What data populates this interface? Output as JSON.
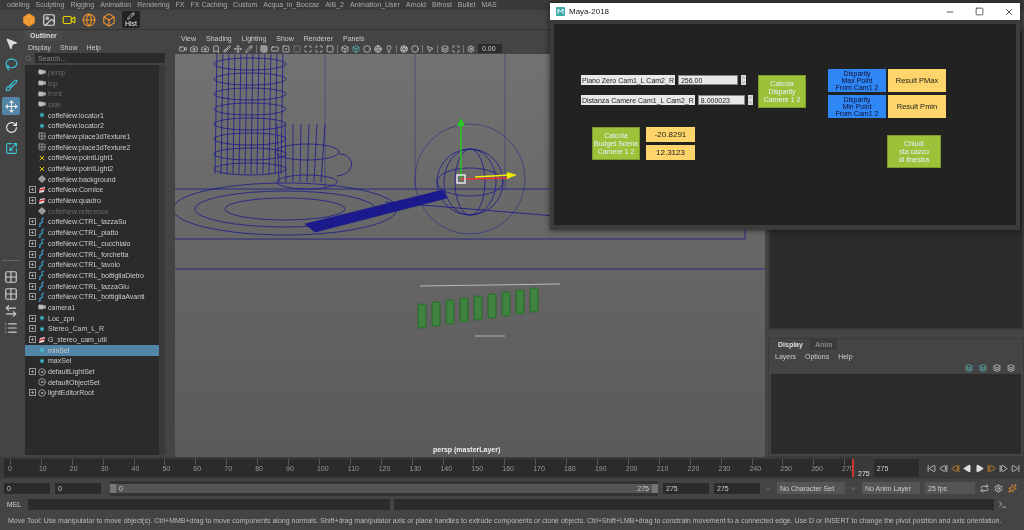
{
  "shelf_tabs": [
    "odeling",
    "Sculpting",
    "Rigging",
    "Animation",
    "Rendering",
    "FX",
    "FX Caching",
    "Custom",
    "Acqua_in_Boccaz",
    "AiB_2",
    "Animation_User",
    "Arnold",
    "Bifrost",
    "Bullet",
    "MAS"
  ],
  "shelf": {
    "hist_label": "Hist"
  },
  "tools": [
    {
      "kind": "select",
      "selected": false
    },
    {
      "kind": "lasso",
      "selected": false
    },
    {
      "kind": "paint",
      "selected": false
    },
    {
      "kind": "move",
      "selected": true
    },
    {
      "kind": "rotate",
      "selected": false
    },
    {
      "kind": "scale",
      "selected": false
    }
  ],
  "outliner": {
    "title": "Outliner",
    "menu": [
      "Display",
      "Show",
      "Help"
    ],
    "search": {
      "placeholder": "Search..."
    },
    "items": [
      {
        "label": "persp",
        "kind": "camera",
        "dimmed": true,
        "expandable": false,
        "selected": false
      },
      {
        "label": "top",
        "kind": "camera",
        "dimmed": true,
        "expandable": false,
        "selected": false
      },
      {
        "label": "front",
        "kind": "camera",
        "dimmed": true,
        "expandable": false,
        "selected": false
      },
      {
        "label": "side",
        "kind": "camera",
        "dimmed": true,
        "expandable": false,
        "selected": false
      },
      {
        "label": "coffeNew:locator1",
        "kind": "locator",
        "dimmed": false,
        "expandable": false,
        "selected": false
      },
      {
        "label": "coffeNew:locator2",
        "kind": "locator",
        "dimmed": false,
        "expandable": false,
        "selected": false
      },
      {
        "label": "coffeNew:place3dTexture1",
        "kind": "texture",
        "dimmed": false,
        "expandable": false,
        "selected": false
      },
      {
        "label": "coffeNew:place3dTexture2",
        "kind": "texture",
        "dimmed": false,
        "expandable": false,
        "selected": false
      },
      {
        "label": "coffeNew:pointLight1",
        "kind": "light",
        "dimmed": false,
        "expandable": false,
        "selected": false
      },
      {
        "label": "coffeNew:pointLight2",
        "kind": "light",
        "dimmed": false,
        "expandable": false,
        "selected": false
      },
      {
        "label": "coffeNew:background",
        "kind": "transform",
        "dimmed": false,
        "expandable": false,
        "selected": false
      },
      {
        "label": "coffeNew:Cornice",
        "kind": "mesh",
        "dimmed": false,
        "expandable": true,
        "selected": false
      },
      {
        "label": "coffeNew:quadro",
        "kind": "mesh",
        "dimmed": false,
        "expandable": true,
        "selected": false
      },
      {
        "label": "coffeNew:reference",
        "kind": "transform",
        "dimmed": true,
        "expandable": false,
        "selected": false
      },
      {
        "label": "coffeNew:CTRL_tazzaSu",
        "kind": "curve",
        "dimmed": false,
        "expandable": true,
        "selected": false
      },
      {
        "label": "coffeNew:CTRL_piatto",
        "kind": "curve",
        "dimmed": false,
        "expandable": true,
        "selected": false
      },
      {
        "label": "coffeNew:CTRL_cucchiaio",
        "kind": "curve",
        "dimmed": false,
        "expandable": true,
        "selected": false
      },
      {
        "label": "coffeNew:CTRL_forchetta",
        "kind": "curve",
        "dimmed": false,
        "expandable": true,
        "selected": false
      },
      {
        "label": "coffeNew:CTRL_tavolo",
        "kind": "curve",
        "dimmed": false,
        "expandable": true,
        "selected": false
      },
      {
        "label": "coffeNew:CTRL_bottigliaDietro",
        "kind": "curve",
        "dimmed": false,
        "expandable": true,
        "selected": false
      },
      {
        "label": "coffeNew:CTRL_tazzaGiu",
        "kind": "curve",
        "dimmed": false,
        "expandable": true,
        "selected": false
      },
      {
        "label": "coffeNew:CTRL_bottigliaAvanti",
        "kind": "curve",
        "dimmed": false,
        "expandable": true,
        "selected": false
      },
      {
        "label": "camera1",
        "kind": "camera",
        "dimmed": false,
        "expandable": false,
        "selected": false
      },
      {
        "label": "Loc_zpn",
        "kind": "locator",
        "dimmed": false,
        "expandable": true,
        "selected": false
      },
      {
        "label": "Stereo_Cam_L_R",
        "kind": "locator",
        "dimmed": false,
        "expandable": true,
        "selected": false
      },
      {
        "label": "G_stereo_cam_util",
        "kind": "mesh",
        "dimmed": false,
        "expandable": true,
        "selected": false
      },
      {
        "label": "minSel",
        "kind": "locator",
        "dimmed": false,
        "expandable": false,
        "selected": true
      },
      {
        "label": "maxSel",
        "kind": "locator",
        "dimmed": false,
        "expandable": false,
        "selected": false
      },
      {
        "label": "defaultLightSet",
        "kind": "set",
        "dimmed": false,
        "expandable": true,
        "selected": false
      },
      {
        "label": "defaultObjectSet",
        "kind": "set",
        "dimmed": false,
        "expandable": false,
        "selected": false
      },
      {
        "label": "lightEditorRoot",
        "kind": "set",
        "dimmed": false,
        "expandable": true,
        "selected": false
      }
    ]
  },
  "viewport": {
    "menu": [
      "View",
      "Shading",
      "Lighting",
      "Show",
      "Renderer",
      "Panels"
    ],
    "value_field": "0.00",
    "camera_label": "persp (masterLayer)"
  },
  "dialog": {
    "title": "Maya-2018",
    "fields": [
      {
        "label": "Piano Zero Cam1_L Cam2_R",
        "value": "256.00"
      },
      {
        "label": "Distanza Camere Cam1_L Cam2_R",
        "value": "8.000023"
      }
    ],
    "disparity_button": "Calcola\nDisparity\nCamere 1 2",
    "results": [
      {
        "button": "Disparity\nMax Point\nFrom Cam1 2",
        "value": "Result PMax"
      },
      {
        "button": "Disparity\nMin Point\nFrom Cam1 2",
        "value": "Result Pmin"
      }
    ],
    "budget_button": "Calcola\nBudget Scena\nCamere 1 2",
    "budget_values": [
      "-20.8291",
      "12.3123"
    ],
    "close_button": "Chiudi\nsta cazzo\ndi finestra"
  },
  "channel_box": {
    "tabs": [
      {
        "label": "Display",
        "selected": true
      },
      {
        "label": "Anim",
        "selected": false
      }
    ],
    "menu": [
      "Layers",
      "Options",
      "Help"
    ]
  },
  "timeline": {
    "ticks": [
      "0",
      "10",
      "20",
      "30",
      "40",
      "50",
      "60",
      "70",
      "80",
      "90",
      "100",
      "110",
      "120",
      "130",
      "140",
      "150",
      "160",
      "170",
      "180",
      "190",
      "200",
      "210",
      "220",
      "230",
      "240",
      "250",
      "260",
      "270"
    ],
    "current_frame": "275",
    "frame_field": "275",
    "level": 1
  },
  "range": {
    "start": "0",
    "anim_start": "0",
    "slider_start": "0",
    "slider_end": "275",
    "level": 1,
    "anim_end": "275",
    "end": "275",
    "character_set": "No Character Set",
    "anim_layer": "No Anim Layer",
    "fps": "25 fps"
  },
  "command_line": {
    "label": "MEL"
  },
  "help_line": "Move Tool: Use manipulator to move object(s). Ctrl+MMB+drag to move components along normals. Shift+drag manipulator axis or plane handles to extrude components or clone objects. Ctrl+Shift+LMB+drag to constrain movement to a connected edge. Use D or INSERT to change the pivot position and axis orientation."
}
